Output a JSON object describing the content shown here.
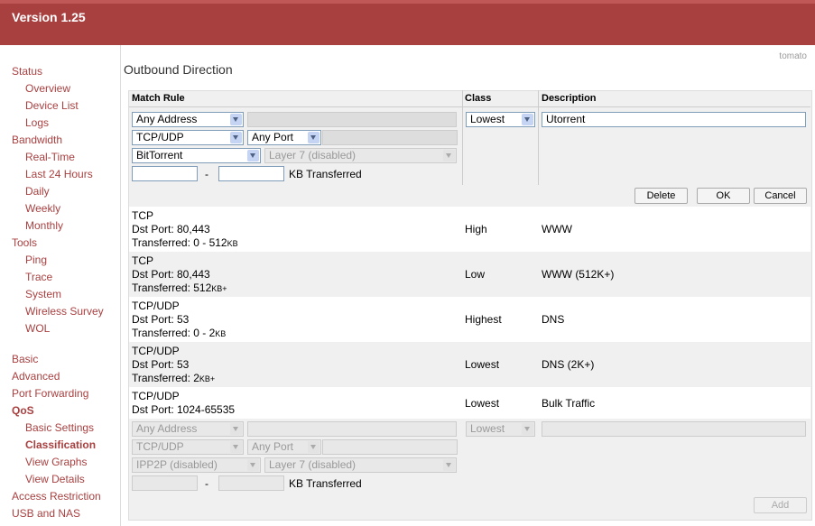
{
  "header": {
    "version": "Version 1.25",
    "brand": "tomato"
  },
  "sidebar": {
    "status": "Status",
    "overview": "Overview",
    "device_list": "Device List",
    "logs": "Logs",
    "bandwidth": "Bandwidth",
    "realtime": "Real-Time",
    "last24": "Last 24 Hours",
    "daily": "Daily",
    "weekly": "Weekly",
    "monthly": "Monthly",
    "tools": "Tools",
    "ping": "Ping",
    "trace": "Trace",
    "system": "System",
    "wireless_survey": "Wireless Survey",
    "wol": "WOL",
    "basic": "Basic",
    "advanced": "Advanced",
    "port_forwarding": "Port Forwarding",
    "qos": "QoS",
    "basic_settings": "Basic Settings",
    "classification": "Classification",
    "view_graphs": "View Graphs",
    "view_details": "View Details",
    "access_restriction": "Access Restriction",
    "usb_nas": "USB and NAS"
  },
  "page": {
    "title": "Outbound Direction"
  },
  "table": {
    "col_match": "Match Rule",
    "col_class": "Class",
    "col_desc": "Description"
  },
  "editor": {
    "address": "Any Address",
    "address_value": "",
    "protocol": "TCP/UDP",
    "port": "Any Port",
    "port_value": "",
    "ipp2p": "BitTorrent",
    "layer7": "Layer 7 (disabled)",
    "kb_from": "",
    "dash": "-",
    "kb_to": "",
    "kb_label": "KB Transferred",
    "class": "Lowest",
    "description": "Utorrent",
    "delete": "Delete",
    "ok": "OK",
    "cancel": "Cancel"
  },
  "rows": [
    {
      "proto": "TCP",
      "port": "Dst Port: 80,443",
      "xfer": "Transferred: 0 - 512",
      "unit": "KB",
      "cls": "High",
      "desc": "WWW"
    },
    {
      "proto": "TCP",
      "port": "Dst Port: 80,443",
      "xfer": "Transferred: 512",
      "unit": "KB+",
      "cls": "Low",
      "desc": "WWW (512K+)"
    },
    {
      "proto": "TCP/UDP",
      "port": "Dst Port: 53",
      "xfer": "Transferred: 0 - 2",
      "unit": "KB",
      "cls": "Highest",
      "desc": "DNS"
    },
    {
      "proto": "TCP/UDP",
      "port": "Dst Port: 53",
      "xfer": "Transferred: 2",
      "unit": "KB+",
      "cls": "Lowest",
      "desc": "DNS (2K+)"
    },
    {
      "proto": "TCP/UDP",
      "port": "Dst Port: 1024-65535",
      "xfer": "",
      "unit": "",
      "cls": "Lowest",
      "desc": "Bulk Traffic"
    }
  ],
  "new_rule": {
    "address": "Any Address",
    "protocol": "TCP/UDP",
    "port": "Any Port",
    "ipp2p": "IPP2P (disabled)",
    "layer7": "Layer 7 (disabled)",
    "dash": "-",
    "kb_label": "KB Transferred",
    "class": "Lowest",
    "add": "Add"
  }
}
